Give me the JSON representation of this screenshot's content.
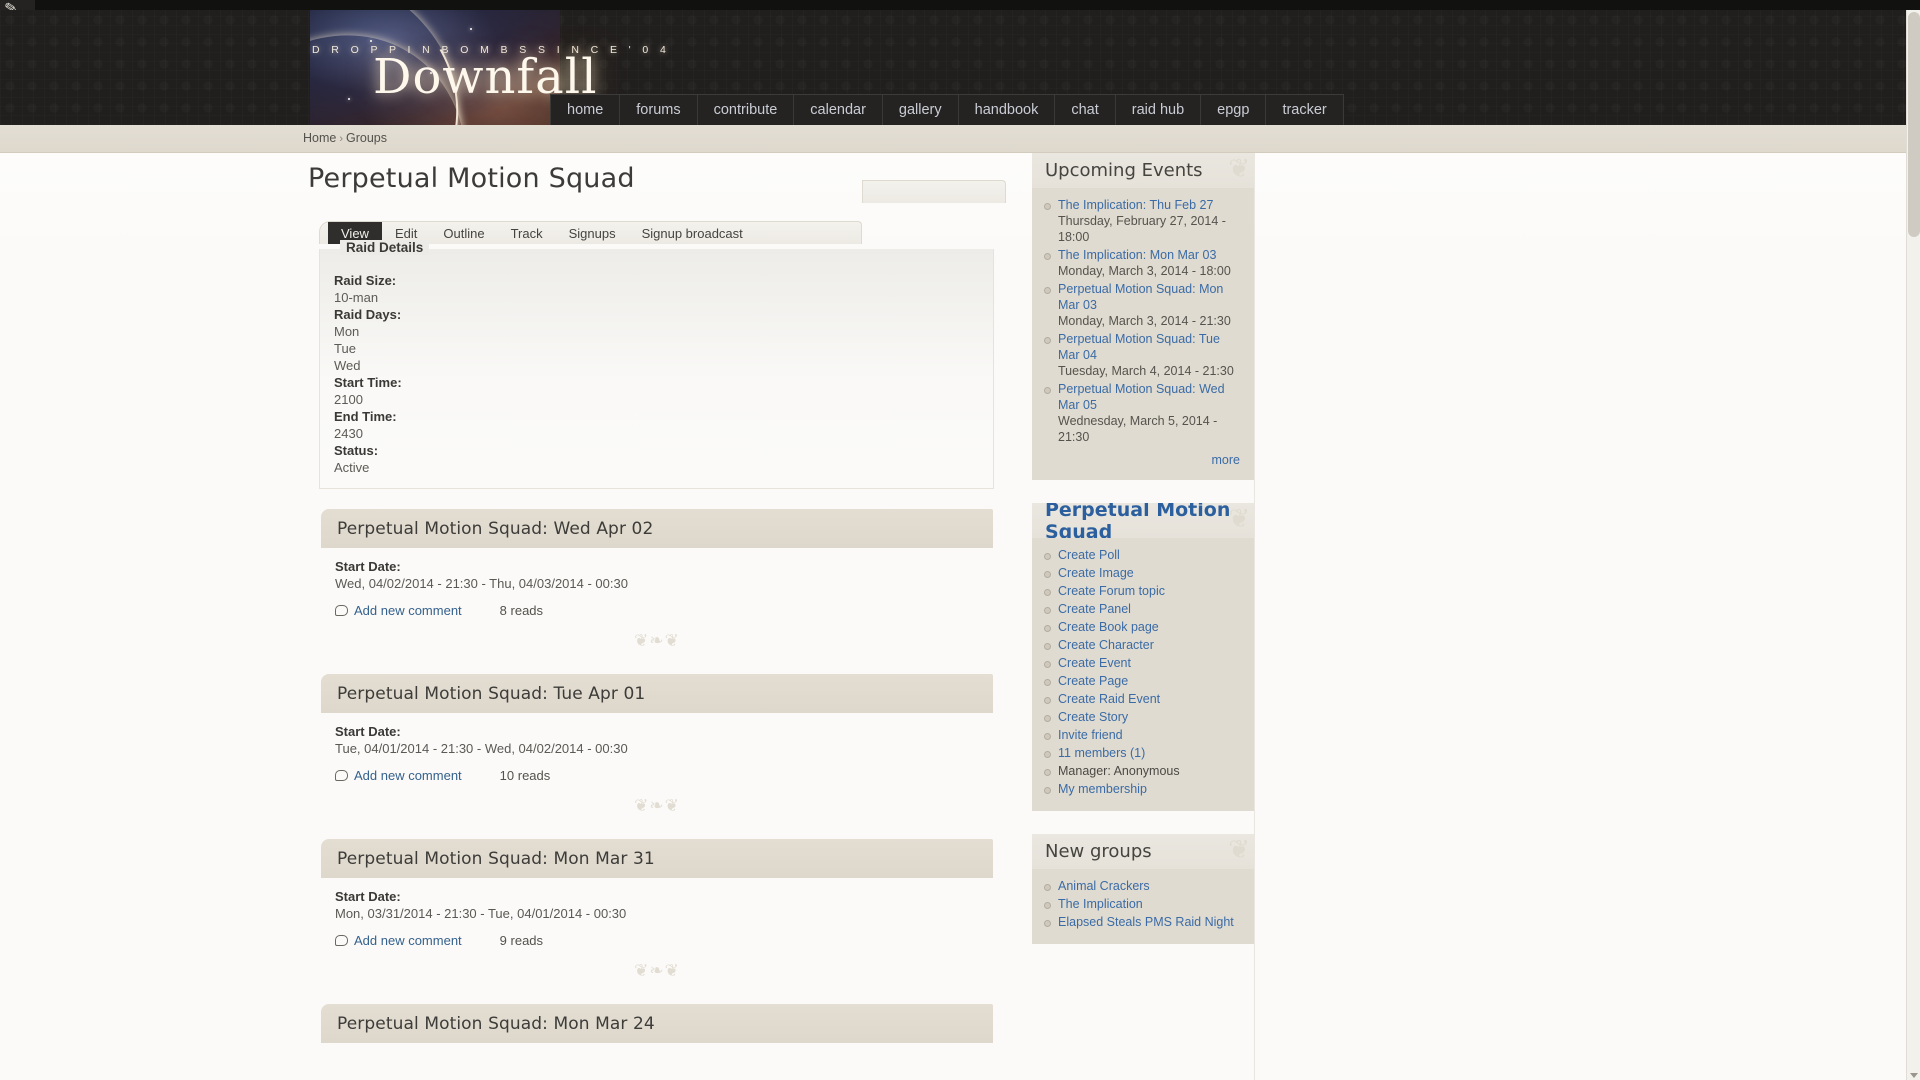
{
  "site": {
    "tagline": "D R O P P I N   B O M B S   S I N C E   ' 0 4",
    "logo": "Downfall",
    "corner_glyph": "✎"
  },
  "nav": {
    "items": [
      {
        "label": "home",
        "active": false
      },
      {
        "label": "forums",
        "active": false
      },
      {
        "label": "contribute",
        "active": false
      },
      {
        "label": "calendar",
        "active": false
      },
      {
        "label": "gallery",
        "active": false
      },
      {
        "label": "handbook",
        "active": false
      },
      {
        "label": "chat",
        "active": false
      },
      {
        "label": "raid hub",
        "active": false
      },
      {
        "label": "epgp",
        "active": false
      },
      {
        "label": "tracker",
        "active": false
      }
    ]
  },
  "breadcrumb": {
    "home": "Home",
    "separator": "›",
    "current": "Groups"
  },
  "main": {
    "title": "Perpetual Motion Squad",
    "tabs": [
      {
        "label": "View",
        "active": true
      },
      {
        "label": "Edit",
        "active": false
      },
      {
        "label": "Outline",
        "active": false
      },
      {
        "label": "Track",
        "active": false
      },
      {
        "label": "Signups",
        "active": false
      },
      {
        "label": "Signup broadcast",
        "active": false
      }
    ],
    "raid_details": {
      "legend": "Raid Details",
      "fields": [
        {
          "label": "Raid Size:",
          "values": [
            "10-man"
          ]
        },
        {
          "label": "Raid Days:",
          "values": [
            "Mon",
            "Tue",
            "Wed"
          ]
        },
        {
          "label": "Start Time:",
          "values": [
            "2100"
          ]
        },
        {
          "label": "End Time:",
          "values": [
            "2430"
          ]
        },
        {
          "label": "Status:",
          "values": [
            "Active"
          ]
        }
      ]
    },
    "start_date_label": "Start Date:",
    "comment_link": "Add new comment",
    "events": [
      {
        "title": "Perpetual Motion Squad: Wed Apr 02",
        "date": "Wed, 04/02/2014 - 21:30 - Thu, 04/03/2014 - 00:30",
        "reads": "8 reads"
      },
      {
        "title": "Perpetual Motion Squad: Tue Apr 01",
        "date": "Tue, 04/01/2014 - 21:30 - Wed, 04/02/2014 - 00:30",
        "reads": "10 reads"
      },
      {
        "title": "Perpetual Motion Squad: Mon Mar 31",
        "date": "Mon, 03/31/2014 - 21:30 - Tue, 04/01/2014 - 00:30",
        "reads": "9 reads"
      },
      {
        "title": "Perpetual Motion Squad: Mon Mar 24",
        "date": "",
        "reads": ""
      }
    ],
    "divider_ornament": "❦❧❦"
  },
  "sidebar": {
    "upcoming": {
      "heading": "Upcoming Events",
      "items": [
        {
          "link": "The Implication: Thu Feb 27",
          "sub": "Thursday, February 27, 2014 - 18:00"
        },
        {
          "link": "The Implication: Mon Mar 03",
          "sub": "Monday, March 3, 2014 - 18:00"
        },
        {
          "link": "Perpetual Motion Squad: Mon Mar 03",
          "sub": "Monday, March 3, 2014 - 21:30"
        },
        {
          "link": "Perpetual Motion Squad: Tue Mar 04",
          "sub": "Tuesday, March 4, 2014 - 21:30"
        },
        {
          "link": "Perpetual Motion Squad: Wed Mar 05",
          "sub": "Wednesday, March 5, 2014 - 21:30"
        }
      ],
      "more": "more"
    },
    "group": {
      "heading": "Perpetual Motion Squad",
      "items": [
        {
          "link": "Create Poll"
        },
        {
          "link": "Create Image"
        },
        {
          "link": "Create Forum topic"
        },
        {
          "link": "Create Panel"
        },
        {
          "link": "Create Book page"
        },
        {
          "link": "Create Character"
        },
        {
          "link": "Create Event"
        },
        {
          "link": "Create Page"
        },
        {
          "link": "Create Raid Event"
        },
        {
          "link": "Create Story"
        },
        {
          "link": "Invite friend"
        },
        {
          "link": "11 members (1)"
        },
        {
          "text": "Manager: Anonymous"
        },
        {
          "link": "My membership"
        }
      ]
    },
    "new_groups": {
      "heading": "New groups",
      "items": [
        {
          "link": "Animal Crackers"
        },
        {
          "link": "The Implication"
        },
        {
          "link": "Elapsed Steals PMS Raid Night"
        }
      ]
    }
  },
  "colors": {
    "link": "#3a6ba6",
    "heading_blue": "#2c5f9e",
    "header_bg": "#211f1e",
    "sidebar_bg": "#e0dbd0"
  }
}
